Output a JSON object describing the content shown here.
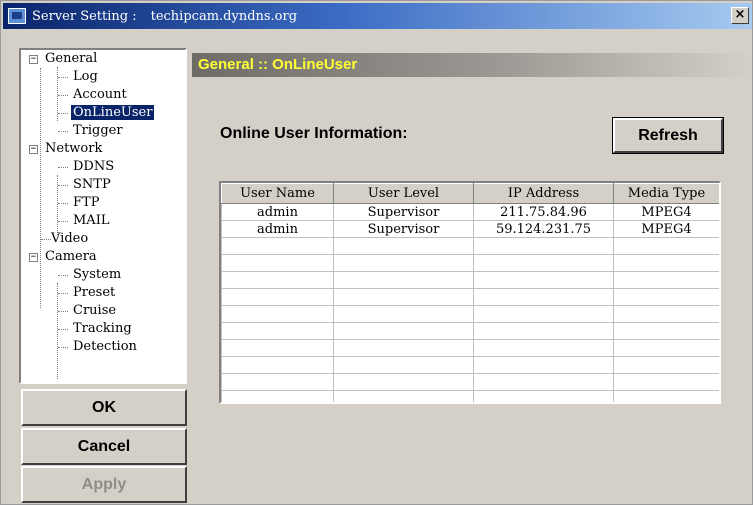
{
  "window": {
    "title_label": "Server Setting :",
    "server_host": "techipcam.dyndns.org",
    "close_glyph": "×",
    "icon": "app-icon"
  },
  "tree": {
    "items": [
      {
        "label": "General",
        "expander": "−"
      },
      {
        "label": "Log"
      },
      {
        "label": "Account"
      },
      {
        "label": "OnLineUser",
        "selected": true
      },
      {
        "label": "Trigger"
      },
      {
        "label": "Network",
        "expander": "−"
      },
      {
        "label": "DDNS"
      },
      {
        "label": "SNTP"
      },
      {
        "label": "FTP"
      },
      {
        "label": "MAIL"
      },
      {
        "label": "Video"
      },
      {
        "label": "Camera",
        "expander": "−"
      },
      {
        "label": "System"
      },
      {
        "label": "Preset"
      },
      {
        "label": "Cruise"
      },
      {
        "label": "Tracking"
      },
      {
        "label": "Detection"
      }
    ]
  },
  "buttons": {
    "ok": "OK",
    "cancel": "Cancel",
    "apply": "Apply",
    "refresh": "Refresh"
  },
  "panel": {
    "header": "General :: OnLineUser",
    "section_title": "Online User Information:"
  },
  "users_table": {
    "columns": [
      "User Name",
      "User Level",
      "IP Address",
      "Media Type"
    ],
    "rows": [
      [
        "admin",
        "Supervisor",
        "211.75.84.96",
        "MPEG4"
      ],
      [
        "admin",
        "Supervisor",
        "59.124.231.75",
        "MPEG4"
      ],
      [
        "",
        "",
        "",
        ""
      ],
      [
        "",
        "",
        "",
        ""
      ],
      [
        "",
        "",
        "",
        ""
      ],
      [
        "",
        "",
        "",
        ""
      ],
      [
        "",
        "",
        "",
        ""
      ],
      [
        "",
        "",
        "",
        ""
      ],
      [
        "",
        "",
        "",
        ""
      ],
      [
        "",
        "",
        "",
        ""
      ],
      [
        "",
        "",
        "",
        ""
      ],
      [
        "",
        "",
        "",
        ""
      ]
    ]
  },
  "colors": {
    "title_gradient_start": "#0a246a",
    "header_text": "#ffff33",
    "selection": "#0a246a"
  }
}
